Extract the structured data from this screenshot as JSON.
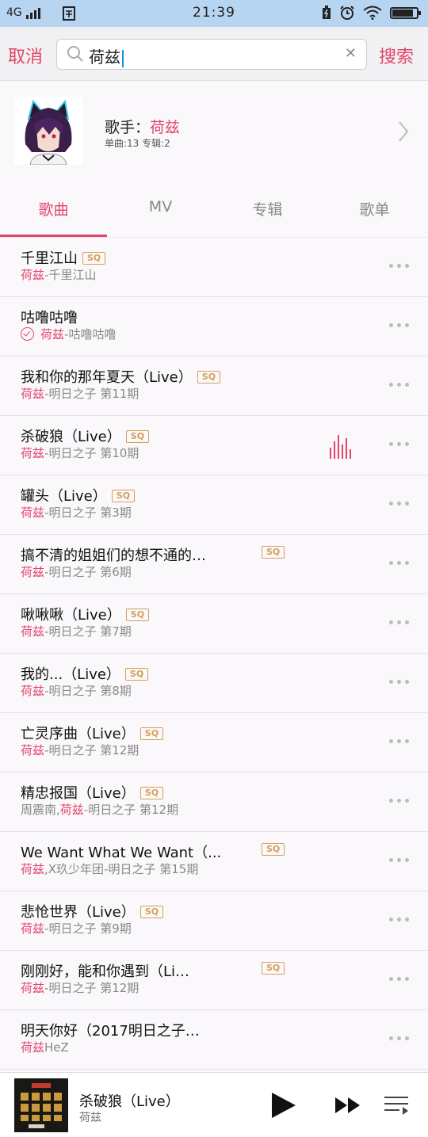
{
  "status": {
    "network": "4G",
    "time": "21:39",
    "battery_level": 0.85
  },
  "search": {
    "cancel_label": "取消",
    "query": "荷兹",
    "search_label": "搜索"
  },
  "artist": {
    "label": "歌手：",
    "name": "荷兹",
    "stats": "单曲:13  专辑:2"
  },
  "tabs": [
    "歌曲",
    "MV",
    "专辑",
    "歌单"
  ],
  "active_tab": 0,
  "songs": [
    {
      "title": "千里江山",
      "sq": true,
      "artists": "荷兹",
      "album": "千里江山"
    },
    {
      "title": "咕噜咕噜",
      "sq": false,
      "downloaded": true,
      "artists": "荷兹",
      "album": "咕噜咕噜"
    },
    {
      "title": "我和你的那年夏天（Live）",
      "sq": true,
      "artists": "荷兹",
      "album": "明日之子 第11期"
    },
    {
      "title": "杀破狼（Live）",
      "sq": true,
      "playing": true,
      "artists": "荷兹",
      "album": "明日之子 第10期"
    },
    {
      "title": "罐头（Live）",
      "sq": true,
      "artists": "荷兹",
      "album": "明日之子 第3期"
    },
    {
      "title": "搞不清的姐姐们的想不通的…",
      "sq": true,
      "sq_right": true,
      "artists": "荷兹",
      "album": "明日之子 第6期"
    },
    {
      "title": "啾啾啾（Live）",
      "sq": true,
      "artists": "荷兹",
      "album": "明日之子 第7期"
    },
    {
      "title": "我的...（Live）",
      "sq": true,
      "artists": "荷兹",
      "album": "明日之子 第8期"
    },
    {
      "title": "亡灵序曲（Live）",
      "sq": true,
      "artists": "荷兹",
      "album": "明日之子 第12期"
    },
    {
      "title": "精忠报国（Live）",
      "sq": true,
      "pre_artist": "周震南,",
      "artists": "荷兹",
      "album": "明日之子 第12期"
    },
    {
      "title": "We Want What We Want（...",
      "sq": true,
      "sq_right": true,
      "artists": "荷兹",
      "artists_extra": ",X玖少年团",
      "album": "明日之子 第15期"
    },
    {
      "title": "悲怆世界（Live）",
      "sq": true,
      "artists": "荷兹",
      "album": "明日之子 第9期"
    },
    {
      "title": "刚刚好，能和你遇到（Li…",
      "sq": true,
      "sq_right": true,
      "artists": "荷兹",
      "album": "明日之子 第12期"
    },
    {
      "title": "明天你好（2017明日之子…",
      "sq": false,
      "artists": "荷兹",
      "suffix": "HeZ",
      "album": ""
    }
  ],
  "sq_label": "SQ",
  "now_playing": {
    "title": "杀破狼（Live）",
    "artist": "荷兹"
  },
  "colors": {
    "accent": "#e3456a",
    "sq_badge": "#d4a057",
    "status_bar": "#b7d4f1"
  }
}
